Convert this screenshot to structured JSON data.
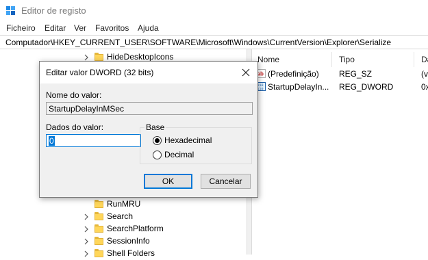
{
  "window": {
    "title": "Editor de registo"
  },
  "menu": [
    "Ficheiro",
    "Editar",
    "Ver",
    "Favoritos",
    "Ajuda"
  ],
  "address": "Computador\\HKEY_CURRENT_USER\\SOFTWARE\\Microsoft\\Windows\\CurrentVersion\\Explorer\\Serialize",
  "tree": {
    "items": [
      {
        "label": "HideDesktopIcons"
      },
      {
        "label": "RunMRU"
      },
      {
        "label": "Search"
      },
      {
        "label": "SearchPlatform"
      },
      {
        "label": "SessionInfo"
      },
      {
        "label": "Shell Folders"
      }
    ]
  },
  "list": {
    "columns": [
      "Nome",
      "Tipo",
      "Da"
    ],
    "rows": [
      {
        "name": "(Predefinição)",
        "type": "REG_SZ",
        "data": "(v",
        "icon": "string-value-icon"
      },
      {
        "name": "StartupDelayIn...",
        "type": "REG_DWORD",
        "data": "0x",
        "icon": "binary-value-icon"
      }
    ]
  },
  "dialog": {
    "title": "Editar valor DWORD (32 bits)",
    "value_name_label": "Nome do valor:",
    "value_name": "StartupDelayInMSec",
    "value_data_label": "Dados do valor:",
    "value_data": "0",
    "base_label": "Base",
    "base_options": [
      "Hexadecimal",
      "Decimal"
    ],
    "base_selected": "Hexadecimal",
    "ok_label": "OK",
    "cancel_label": "Cancelar"
  },
  "colors": {
    "accent": "#0078d7",
    "folder": "#ffd65a"
  }
}
